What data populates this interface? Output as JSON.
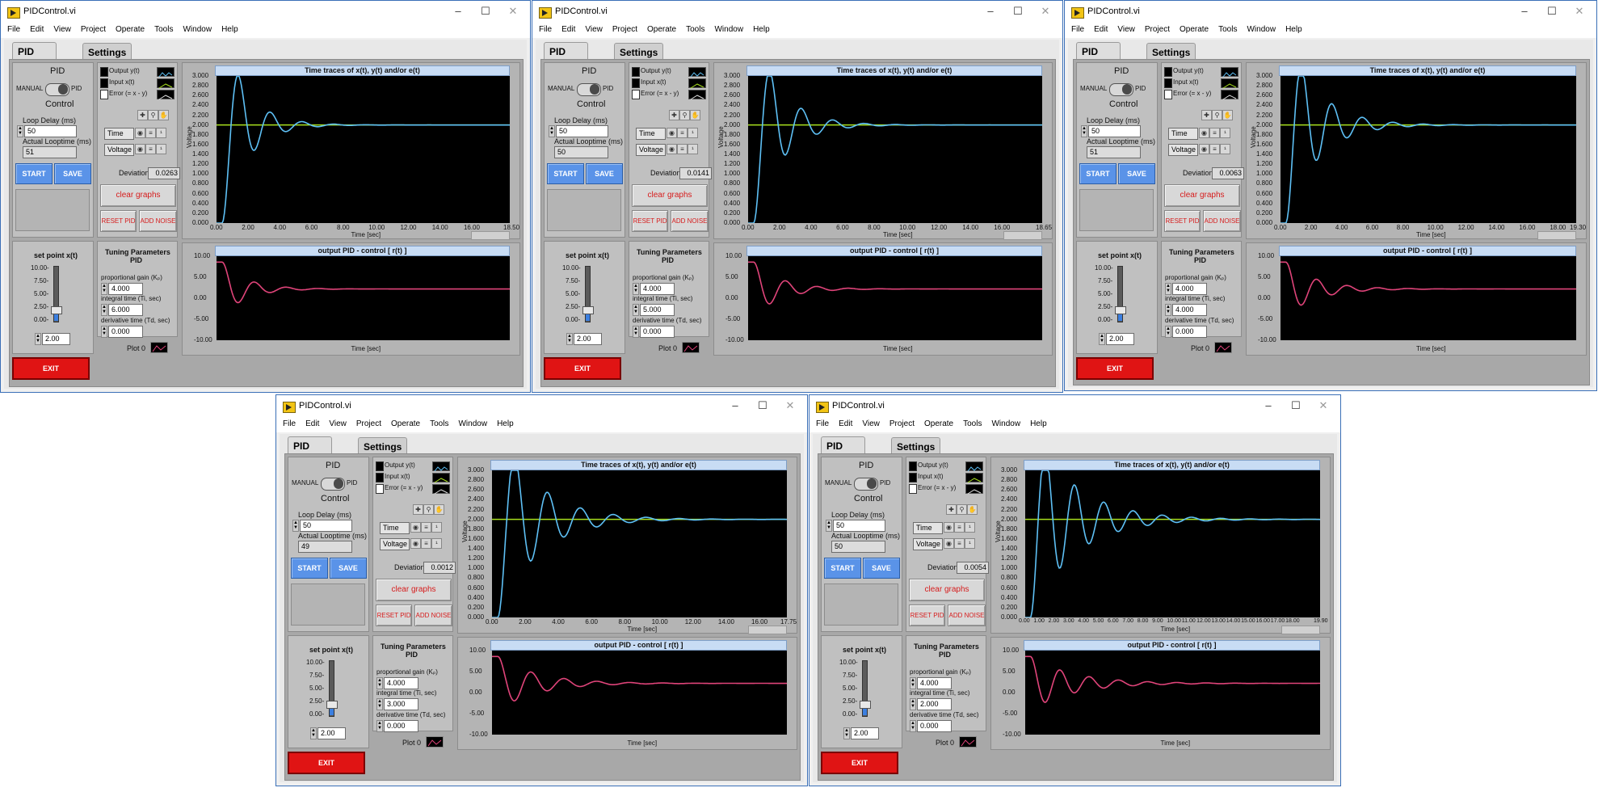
{
  "app": {
    "window_title": "PIDControl.vi",
    "menu": [
      "File",
      "Edit",
      "View",
      "Project",
      "Operate",
      "Tools",
      "Window",
      "Help"
    ],
    "tabs": [
      "PID control",
      "Settings"
    ],
    "manual_label": "MANUAL",
    "pid_label": "PID",
    "pid_title": "PID",
    "control_label": "Control",
    "legend": [
      "Output y(t)",
      "Input x(t)",
      "Error (= x - y)"
    ],
    "cursor_time": "Time",
    "cursor_voltage": "Voltage",
    "loop_delay_label": "Loop Delay (ms)",
    "actual_looptime_label": "Actual Looptime (ms)",
    "start": "START",
    "save": "SAVE",
    "deviation_label": "Deviation",
    "clear_graphs": "clear graphs",
    "reset_pid": "RESET PID",
    "add_noise": "ADD NOISE",
    "set_point_label": "set point x(t)",
    "tuning_title": "Tuning Parameters",
    "tuning_sub": "PID",
    "kp_label": "proportional gain (Kₚ)",
    "ti_label": "integral time (Ti, sec)",
    "td_label": "derivative time (Td, sec)",
    "exit": "EXIT",
    "plot0": "Plot 0",
    "graph1_title": "Time traces of x(t), y(t) and/or e(t)",
    "graph2_title": "output PID - control [ r(t) ]",
    "y_label": "Voltage",
    "x_label": "Time [sec]",
    "slider_ticks": [
      "10.00-",
      "7.50-",
      "5.00-",
      "2.50-",
      "0.00-"
    ],
    "g1_yticks": [
      "3.000",
      "2.800",
      "2.600",
      "2.400",
      "2.200",
      "2.000",
      "1.800",
      "1.600",
      "1.400",
      "1.200",
      "1.000",
      "0.800",
      "0.600",
      "0.400",
      "0.200",
      "0.000"
    ],
    "g2_yticks": [
      "10.00",
      "5.00",
      "0.00",
      "-5.00",
      "-10.00"
    ],
    "colors": {
      "output_trace": "#5ec0f5",
      "input_trace": "#a8e01e",
      "control_trace": "#e0447a",
      "graph_bg": "#000000",
      "exit_btn": "#e01414",
      "blue_btn": "#5a93e8"
    },
    "icons": [
      "vi-app-icon",
      "minimize-icon",
      "maximize-icon",
      "close-icon",
      "cursor-tool-icon",
      "zoom-tool-icon",
      "pan-tool-icon",
      "lock-icon",
      "format-icon",
      "legend-line-icon"
    ]
  },
  "windows": [
    {
      "loop_delay": "50",
      "actual_looptime": "51",
      "deviation": "0.0263",
      "set_point": "2.00",
      "kp": "4.000",
      "ti": "6.000",
      "td": "0.000",
      "xticks": [
        "0.00",
        "2.00",
        "4.00",
        "6.00",
        "8.00",
        "10.00",
        "12.00",
        "14.00",
        "16.00",
        "18.50"
      ],
      "xmax": 18.5
    },
    {
      "loop_delay": "50",
      "actual_looptime": "50",
      "deviation": "0.0141",
      "set_point": "2.00",
      "kp": "4.000",
      "ti": "5.000",
      "td": "0.000",
      "xticks": [
        "0.00",
        "2.00",
        "4.00",
        "6.00",
        "8.00",
        "10.00",
        "12.00",
        "14.00",
        "16.00",
        "18.65"
      ],
      "xmax": 18.65
    },
    {
      "loop_delay": "50",
      "actual_looptime": "51",
      "deviation": "0.0063",
      "set_point": "2.00",
      "kp": "4.000",
      "ti": "4.000",
      "td": "0.000",
      "xticks": [
        "0.00",
        "2.00",
        "4.00",
        "6.00",
        "8.00",
        "10.00",
        "12.00",
        "14.00",
        "16.00",
        "18.00",
        "19.30"
      ],
      "xmax": 19.3
    },
    {
      "loop_delay": "50",
      "actual_looptime": "49",
      "deviation": "0.0012",
      "set_point": "2.00",
      "kp": "4.000",
      "ti": "3.000",
      "td": "0.000",
      "xticks": [
        "0.00",
        "2.00",
        "4.00",
        "6.00",
        "8.00",
        "10.00",
        "12.00",
        "14.00",
        "16.00",
        "17.75"
      ],
      "xmax": 17.75
    },
    {
      "loop_delay": "50",
      "actual_looptime": "50",
      "deviation": "0.0054",
      "set_point": "2.00",
      "kp": "4.000",
      "ti": "2.000",
      "td": "0.000",
      "xticks": [
        "0.00",
        "1.00",
        "2.00",
        "3.00",
        "4.00",
        "5.00",
        "6.00",
        "7.00",
        "8.00",
        "9.00",
        "10.00",
        "11.00",
        "12.00",
        "13.00",
        "14.00",
        "15.00",
        "16.00",
        "17.00",
        "18.00",
        "19.90"
      ],
      "xmax": 19.9
    }
  ]
}
